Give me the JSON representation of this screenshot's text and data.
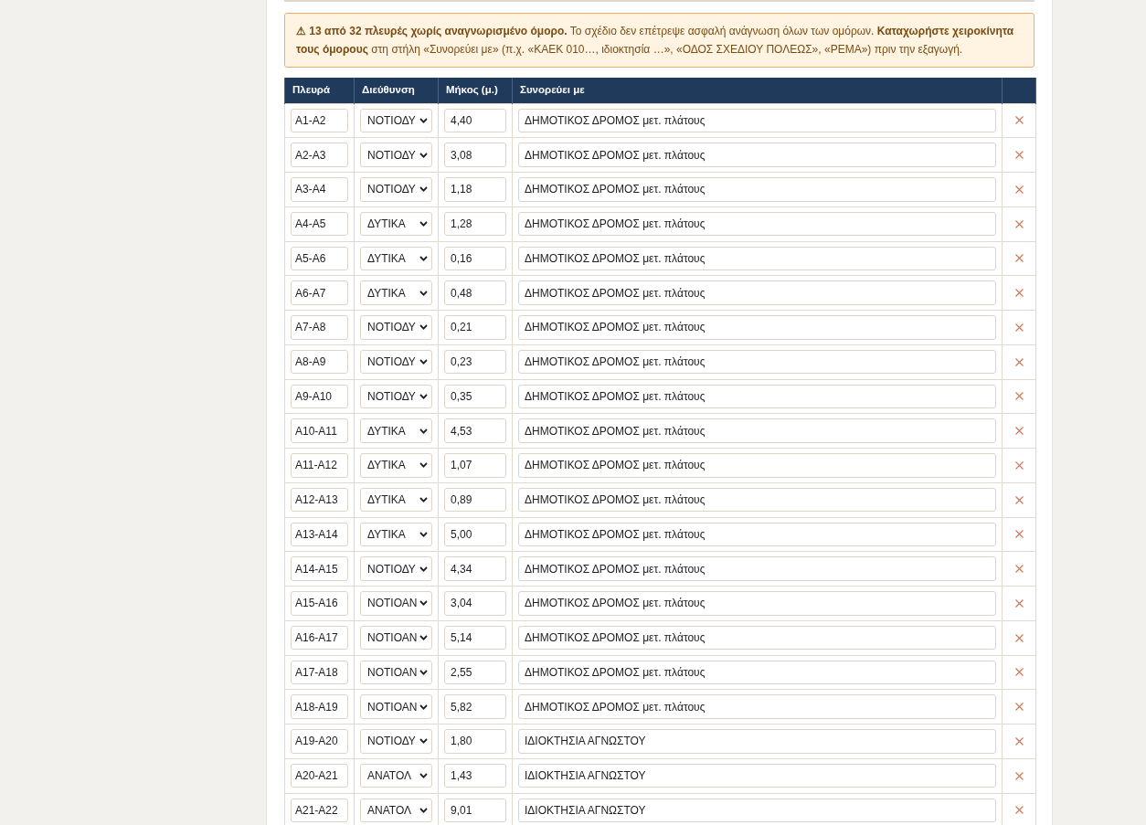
{
  "notice": {
    "text": "**⚠ 13 από 32 πλευρές χωρίς αναγνωρισμένο όμορο.** Το σχέδιο δεν επέτρεψε ασφαλή ανάγνωση όλων των ομόρων. **Καταχωρήστε χειροκίνητα τους όμορους** στη στήλη «Συνορεύει με» (π.χ. «ΚΑΕΚ 010…, ιδιοκτησία …», «ΟΔΟΣ ΣΧΕΔΙΟΥ ΠΟΛΕΩΣ», «ΡΕΜΑ») πριν την εξαγωγή."
  },
  "table": {
    "columns": [
      "Πλευρά",
      "Διεύθυνση",
      "Μήκος (μ.)",
      "Συνορεύει με"
    ],
    "rows": [
      {
        "edge": "Α1-Α2",
        "direction": "ΝΟΤΙΟΔΥ",
        "length": "4,40",
        "neighbor": "ΔΗΜΟΤΙΚΟΣ ΔΡΟΜΟΣ μετ. πλάτους"
      },
      {
        "edge": "Α2-Α3",
        "direction": "ΝΟΤΙΟΔΥ",
        "length": "3,08",
        "neighbor": "ΔΗΜΟΤΙΚΟΣ ΔΡΟΜΟΣ μετ. πλάτους"
      },
      {
        "edge": "Α3-Α4",
        "direction": "ΝΟΤΙΟΔΥ",
        "length": "1,18",
        "neighbor": "ΔΗΜΟΤΙΚΟΣ ΔΡΟΜΟΣ μετ. πλάτους"
      },
      {
        "edge": "Α4-Α5",
        "direction": "ΔΥΤΙΚΑ",
        "length": "1,28",
        "neighbor": "ΔΗΜΟΤΙΚΟΣ ΔΡΟΜΟΣ μετ. πλάτους"
      },
      {
        "edge": "Α5-Α6",
        "direction": "ΔΥΤΙΚΑ",
        "length": "0,16",
        "neighbor": "ΔΗΜΟΤΙΚΟΣ ΔΡΟΜΟΣ μετ. πλάτους"
      },
      {
        "edge": "Α6-Α7",
        "direction": "ΔΥΤΙΚΑ",
        "length": "0,48",
        "neighbor": "ΔΗΜΟΤΙΚΟΣ ΔΡΟΜΟΣ μετ. πλάτους"
      },
      {
        "edge": "Α7-Α8",
        "direction": "ΝΟΤΙΟΔΥ",
        "length": "0,21",
        "neighbor": "ΔΗΜΟΤΙΚΟΣ ΔΡΟΜΟΣ μετ. πλάτους"
      },
      {
        "edge": "Α8-Α9",
        "direction": "ΝΟΤΙΟΔΥ",
        "length": "0,23",
        "neighbor": "ΔΗΜΟΤΙΚΟΣ ΔΡΟΜΟΣ μετ. πλάτους"
      },
      {
        "edge": "Α9-Α10",
        "direction": "ΝΟΤΙΟΔΥ",
        "length": "0,35",
        "neighbor": "ΔΗΜΟΤΙΚΟΣ ΔΡΟΜΟΣ μετ. πλάτους"
      },
      {
        "edge": "Α10-Α11",
        "direction": "ΔΥΤΙΚΑ",
        "length": "4,53",
        "neighbor": "ΔΗΜΟΤΙΚΟΣ ΔΡΟΜΟΣ μετ. πλάτους"
      },
      {
        "edge": "Α11-Α12",
        "direction": "ΔΥΤΙΚΑ",
        "length": "1,07",
        "neighbor": "ΔΗΜΟΤΙΚΟΣ ΔΡΟΜΟΣ μετ. πλάτους"
      },
      {
        "edge": "Α12-Α13",
        "direction": "ΔΥΤΙΚΑ",
        "length": "0,89",
        "neighbor": "ΔΗΜΟΤΙΚΟΣ ΔΡΟΜΟΣ μετ. πλάτους"
      },
      {
        "edge": "Α13-Α14",
        "direction": "ΔΥΤΙΚΑ",
        "length": "5,00",
        "neighbor": "ΔΗΜΟΤΙΚΟΣ ΔΡΟΜΟΣ μετ. πλάτους"
      },
      {
        "edge": "Α14-Α15",
        "direction": "ΝΟΤΙΟΔΥ",
        "length": "4,34",
        "neighbor": "ΔΗΜΟΤΙΚΟΣ ΔΡΟΜΟΣ μετ. πλάτους"
      },
      {
        "edge": "Α15-Α16",
        "direction": "ΝΟΤΙΟΑΝ",
        "length": "3,04",
        "neighbor": "ΔΗΜΟΤΙΚΟΣ ΔΡΟΜΟΣ μετ. πλάτους"
      },
      {
        "edge": "Α16-Α17",
        "direction": "ΝΟΤΙΟΑΝ",
        "length": "5,14",
        "neighbor": "ΔΗΜΟΤΙΚΟΣ ΔΡΟΜΟΣ μετ. πλάτους"
      },
      {
        "edge": "Α17-Α18",
        "direction": "ΝΟΤΙΟΑΝ",
        "length": "2,55",
        "neighbor": "ΔΗΜΟΤΙΚΟΣ ΔΡΟΜΟΣ μετ. πλάτους"
      },
      {
        "edge": "Α18-Α19",
        "direction": "ΝΟΤΙΟΑΝ",
        "length": "5,82",
        "neighbor": "ΔΗΜΟΤΙΚΟΣ ΔΡΟΜΟΣ μετ. πλάτους"
      },
      {
        "edge": "Α19-Α20",
        "direction": "ΝΟΤΙΟΔΥ",
        "length": "1,80",
        "neighbor": "ΙΔΙΟΚΤΗΣΙΑ ΑΓΝΩΣΤΟΥ"
      },
      {
        "edge": "Α20-Α21",
        "direction": "ΑΝΑΤΟΛ",
        "length": "1,43",
        "neighbor": "ΙΔΙΟΚΤΗΣΙΑ ΑΓΝΩΣΤΟΥ"
      },
      {
        "edge": "Α21-Α22",
        "direction": "ΑΝΑΤΟΛ",
        "length": "9,01",
        "neighbor": "ΙΔΙΟΚΤΗΣΙΑ ΑΓΝΩΣΤΟΥ"
      }
    ]
  }
}
